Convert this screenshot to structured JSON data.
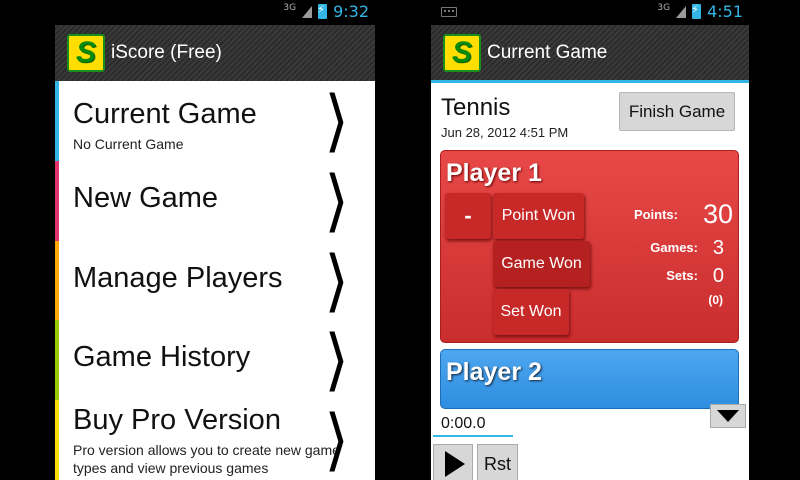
{
  "left_screen": {
    "status": {
      "network": "3G",
      "time": "9:32"
    },
    "app_title": "iScore (Free)",
    "logo_letter": "S",
    "menu": [
      {
        "title": "Current Game",
        "subtitle": "No Current Game",
        "accent": "#33b5e5"
      },
      {
        "title": "New Game",
        "subtitle": "",
        "accent": "#e5336e"
      },
      {
        "title": "Manage Players",
        "subtitle": "",
        "accent": "#ffaa00"
      },
      {
        "title": "Game History",
        "subtitle": "",
        "accent": "#99cc00"
      },
      {
        "title": "Buy Pro Version",
        "subtitle": "Pro version allows you to create new game types and view previous games",
        "accent": "#ffdd00"
      }
    ]
  },
  "right_screen": {
    "status": {
      "network": "3G",
      "time": "4:51"
    },
    "app_title": "Current Game",
    "logo_letter": "S",
    "game": {
      "title": "Tennis",
      "date": "Jun 28, 2012 4:51 PM",
      "finish_label": "Finish Game"
    },
    "player1": {
      "name": "Player 1",
      "minus_label": "-",
      "point_label": "Point Won",
      "game_label": "Game Won",
      "set_label": "Set Won",
      "points_label": "Points:",
      "points": "30",
      "games_label": "Games:",
      "games": "3",
      "sets_label": "Sets:",
      "sets": "0",
      "sets_sub": "(0)",
      "color": "#e84848"
    },
    "player2": {
      "name": "Player 2",
      "color": "#4da6f0"
    },
    "timer": {
      "value": "0:00.0",
      "reset_label": "Rst"
    }
  },
  "colors": {
    "accent": "#33b5e5"
  }
}
